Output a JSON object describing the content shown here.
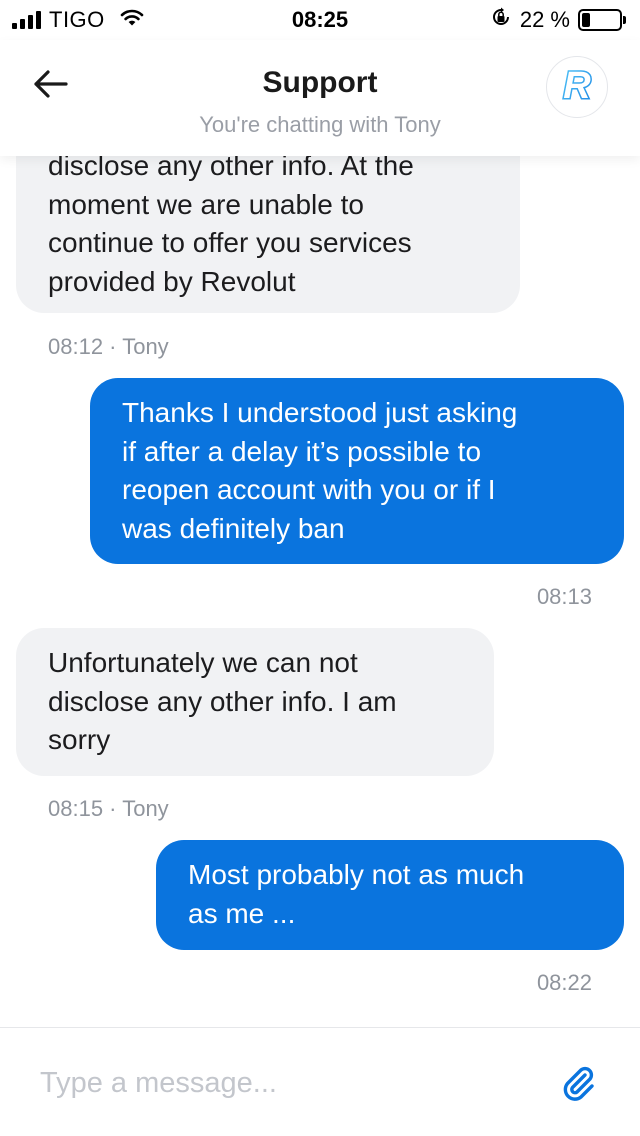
{
  "status_bar": {
    "carrier": "TIGO",
    "time": "08:25",
    "battery": "22 %",
    "battery_level": 0.22,
    "signal_icon": "signal-bars-icon",
    "wifi_icon": "wifi-icon",
    "orientation_lock_icon": "orientation-lock-icon"
  },
  "header": {
    "title": "Support",
    "subtitle": "You're chatting with Tony",
    "back_icon": "arrow-left-icon",
    "logo_icon": "revolut-logo-icon",
    "logo_letter": "R"
  },
  "messages": [
    {
      "direction": "incoming",
      "lines": [
        "disclose any other info. At the",
        "moment we are unable to",
        "continue to offer you services",
        "provided by Revolut"
      ],
      "meta": "08:12 · Tony"
    },
    {
      "direction": "outgoing",
      "lines": [
        "Thanks I understood just asking",
        "if after a delay it’s possible to",
        "reopen account with you or if I",
        "was definitely ban"
      ],
      "meta": "08:13"
    },
    {
      "direction": "incoming",
      "lines": [
        "Unfortunately we can not",
        "disclose any other info. I am",
        "sorry"
      ],
      "meta": "08:15 · Tony"
    },
    {
      "direction": "outgoing",
      "lines": [
        "Most probably not as much",
        "as me ..."
      ],
      "meta": "08:22"
    }
  ],
  "input": {
    "placeholder": "Type a message...",
    "value": "",
    "attach_icon": "paperclip-icon"
  },
  "colors": {
    "accent": "#0a74de",
    "incoming_bubble": "#f1f2f4",
    "meta_text": "#8f949c"
  }
}
